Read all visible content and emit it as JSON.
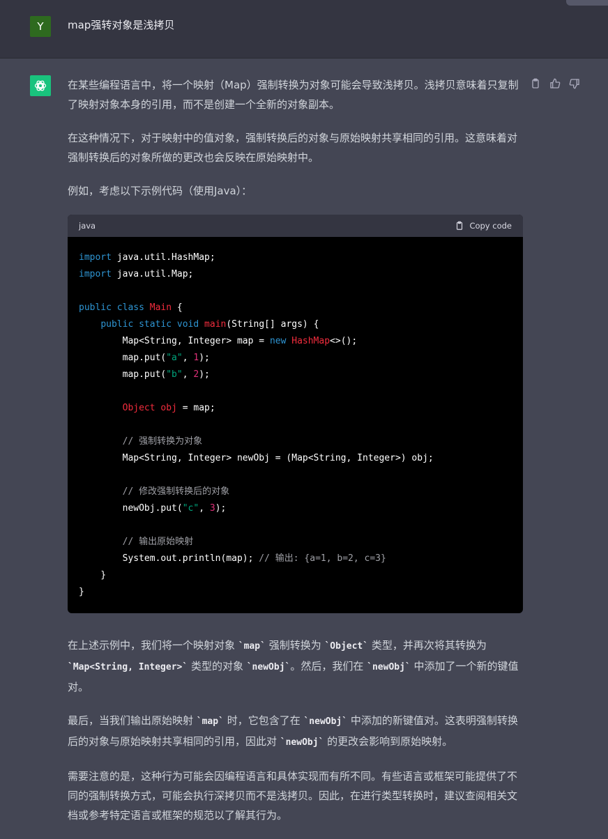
{
  "user": {
    "avatar_letter": "Y",
    "message": "map强转对象是浅拷贝"
  },
  "assistant": {
    "p1": "在某些编程语言中，将一个映射（Map）强制转换为对象可能会导致浅拷贝。浅拷贝意味着只复制了映射对象本身的引用，而不是创建一个全新的对象副本。",
    "p2": "在这种情况下，对于映射中的值对象，强制转换后的对象与原始映射共享相同的引用。这意味着对强制转换后的对象所做的更改也会反映在原始映射中。",
    "p3": "例如，考虑以下示例代码（使用Java）：",
    "code": {
      "language": "java",
      "copy_label": "Copy code",
      "lines": [
        [
          {
            "t": "import",
            "c": "kw"
          },
          {
            "t": " java.util.HashMap;"
          }
        ],
        [
          {
            "t": "import",
            "c": "kw"
          },
          {
            "t": " java.util.Map;"
          }
        ],
        [],
        [
          {
            "t": "public",
            "c": "kw"
          },
          {
            "t": " "
          },
          {
            "t": "class",
            "c": "kw"
          },
          {
            "t": " "
          },
          {
            "t": "Main",
            "c": "cls"
          },
          {
            "t": " {"
          }
        ],
        [
          {
            "t": "    "
          },
          {
            "t": "public",
            "c": "kw"
          },
          {
            "t": " "
          },
          {
            "t": "static",
            "c": "kw"
          },
          {
            "t": " "
          },
          {
            "t": "void",
            "c": "kw"
          },
          {
            "t": " "
          },
          {
            "t": "main",
            "c": "cls"
          },
          {
            "t": "(String[] args) {"
          }
        ],
        [
          {
            "t": "        Map<String, Integer> map = "
          },
          {
            "t": "new",
            "c": "kw"
          },
          {
            "t": " "
          },
          {
            "t": "HashMap",
            "c": "cls"
          },
          {
            "t": "<>();"
          }
        ],
        [
          {
            "t": "        map.put("
          },
          {
            "t": "\"a\"",
            "c": "str"
          },
          {
            "t": ", "
          },
          {
            "t": "1",
            "c": "num"
          },
          {
            "t": ");"
          }
        ],
        [
          {
            "t": "        map.put("
          },
          {
            "t": "\"b\"",
            "c": "str"
          },
          {
            "t": ", "
          },
          {
            "t": "2",
            "c": "num"
          },
          {
            "t": ");"
          }
        ],
        [],
        [
          {
            "t": "        "
          },
          {
            "t": "Object",
            "c": "cls"
          },
          {
            "t": " "
          },
          {
            "t": "obj",
            "c": "cls"
          },
          {
            "t": " = map;"
          }
        ],
        [],
        [
          {
            "t": "        "
          },
          {
            "t": "// 强制转换为对象",
            "c": "com"
          }
        ],
        [
          {
            "t": "        Map<String, Integer> newObj = (Map<String, Integer>) obj;"
          }
        ],
        [],
        [
          {
            "t": "        "
          },
          {
            "t": "// 修改强制转换后的对象",
            "c": "com"
          }
        ],
        [
          {
            "t": "        newObj.put("
          },
          {
            "t": "\"c\"",
            "c": "str"
          },
          {
            "t": ", "
          },
          {
            "t": "3",
            "c": "num"
          },
          {
            "t": ");"
          }
        ],
        [],
        [
          {
            "t": "        "
          },
          {
            "t": "// 输出原始映射",
            "c": "com"
          }
        ],
        [
          {
            "t": "        System.out.println(map); "
          },
          {
            "t": "// 输出: {a=1, b=2, c=3}",
            "c": "com"
          }
        ],
        [
          {
            "t": "    }"
          }
        ],
        [
          {
            "t": "}"
          }
        ]
      ]
    },
    "p4": {
      "s1": "在上述示例中，我们将一个映射对象 ",
      "c1": "`map`",
      "s2": " 强制转换为 ",
      "c2": "`Object`",
      "s3": " 类型，并再次将其转换为 ",
      "c3": "`Map<String, Integer>`",
      "s4": " 类型的对象 ",
      "c4": "`newObj`",
      "s5": "。然后，我们在 ",
      "c5": "`newObj`",
      "s6": " 中添加了一个新的键值对。"
    },
    "p5": {
      "s1": "最后，当我们输出原始映射 ",
      "c1": "`map`",
      "s2": " 时，它包含了在 ",
      "c2": "`newObj`",
      "s3": " 中添加的新键值对。这表明强制转换后的对象与原始映射共享相同的引用，因此对 ",
      "c3": "`newObj`",
      "s4": " 的更改会影响到原始映射。"
    },
    "p6": "需要注意的是，这种行为可能会因编程语言和具体实现而有所不同。有些语言或框架可能提供了不同的强制转换方式，可能会执行深拷贝而不是浅拷贝。因此，在进行类型转换时，建议查阅相关文档或参考特定语言或框架的规范以了解其行为。"
  },
  "icons": {
    "user_avatar": "user-avatar",
    "bot_avatar": "chatgpt-logo-icon",
    "copy": "clipboard-icon",
    "thumbs_up": "thumbs-up-icon",
    "thumbs_down": "thumbs-down-icon"
  },
  "colors": {
    "background": "#444654",
    "user_row": "#343541",
    "user_avatar": "#2e6a1f",
    "bot_avatar": "#19c37d",
    "code_bg": "#000000",
    "code_header": "#343541",
    "keyword": "#2e95d3",
    "class": "#f22c3d",
    "string": "#00a67d",
    "number": "#df3079",
    "comment": "#a0a1a7"
  }
}
